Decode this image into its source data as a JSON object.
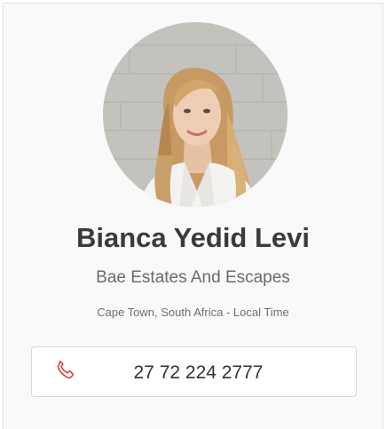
{
  "profile": {
    "name": "Bianca Yedid Levi",
    "company": "Bae Estates And Escapes",
    "location": "Cape Town, South Africa - Local Time",
    "avatar_icon": "profile-photo"
  },
  "contact": {
    "phone": "27 72 224 2777",
    "phone_icon": "phone-icon"
  },
  "colors": {
    "card_background": "#f9f9f9",
    "name_text": "#3a3a3a",
    "secondary_text": "#6b6b6b",
    "phone_icon": "#d23b3b",
    "button_border": "#d7d7d7"
  }
}
